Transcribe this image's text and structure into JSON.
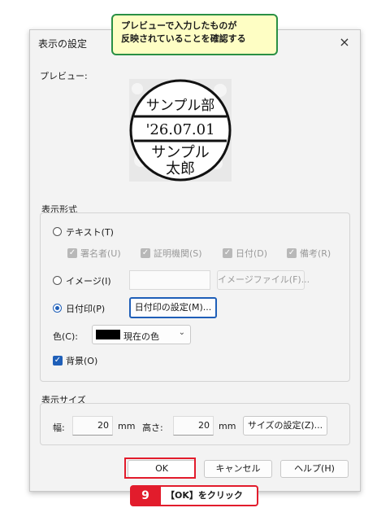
{
  "dialog": {
    "title": "表示の設定",
    "close_icon": "×"
  },
  "callout": {
    "line1": "プレビューで入力したものが",
    "line2": "反映されていることを確認する"
  },
  "preview": {
    "label": "プレビュー:",
    "stamp": {
      "top_text": "サンプル部",
      "date_text": "'26.07.01",
      "bottom_text1": "サンプル",
      "bottom_text2": "太郎"
    }
  },
  "display_format": {
    "title": "表示形式",
    "text_option": "テキスト(T)",
    "text_checks": [
      "署名者(U)",
      "証明機関(S)",
      "日付(D)",
      "備考(R)"
    ],
    "image_option": "イメージ(I)",
    "image_file_button": "イメージファイル(F)...",
    "date_stamp_option": "日付印(P)",
    "date_stamp_settings_button": "日付印の設定(M)...",
    "color_label": "色(C):",
    "color_value": "現在の色",
    "swatch_color": "#000000",
    "background_label": "背景(O)"
  },
  "display_size": {
    "title": "表示サイズ",
    "width_label": "幅:",
    "width_value": "20",
    "width_unit": "mm",
    "height_label": "高さ:",
    "height_value": "20",
    "height_unit": "mm",
    "size_settings_button": "サイズの設定(Z)..."
  },
  "footer": {
    "ok": "OK",
    "cancel": "キャンセル",
    "help": "ヘルプ(H)"
  },
  "step": {
    "number": "9",
    "text": "【OK】をクリック"
  },
  "colors": {
    "accent": "#1f5fb8",
    "highlight_red": "#e21c2c",
    "callout_green": "#2a9045",
    "callout_bg": "#fefec4"
  }
}
